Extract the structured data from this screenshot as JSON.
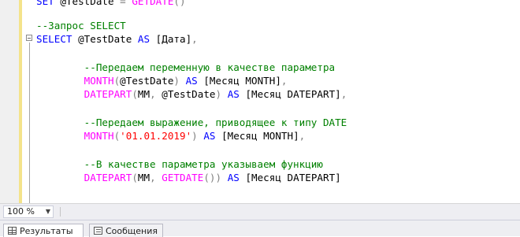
{
  "editor": {
    "lines": [
      {
        "top_clip": true,
        "segments": [
          {
            "c": "kw",
            "t": "SET "
          },
          {
            "c": "tx",
            "t": "@TestDate "
          },
          {
            "c": "op",
            "t": "= "
          },
          {
            "c": "fn",
            "t": "GETDATE"
          },
          {
            "c": "op",
            "t": "()"
          }
        ]
      },
      {
        "segments": [
          {
            "c": "cm",
            "t": "--Запрос SELECT"
          }
        ]
      },
      {
        "segments": [
          {
            "c": "kw",
            "t": "SELECT "
          },
          {
            "c": "tx",
            "t": "@TestDate "
          },
          {
            "c": "kw",
            "t": "AS "
          },
          {
            "c": "tx",
            "t": "[Дата]"
          },
          {
            "c": "op",
            "t": ","
          }
        ]
      },
      {
        "segments": [
          {
            "c": "cm",
            "t": "        --Передаем переменную в качестве параметра"
          }
        ]
      },
      {
        "segments": [
          {
            "c": "fn",
            "t": "        MONTH"
          },
          {
            "c": "op",
            "t": "("
          },
          {
            "c": "tx",
            "t": "@TestDate"
          },
          {
            "c": "op",
            "t": ") "
          },
          {
            "c": "kw",
            "t": "AS "
          },
          {
            "c": "tx",
            "t": "[Месяц MONTH]"
          },
          {
            "c": "op",
            "t": ","
          }
        ]
      },
      {
        "segments": [
          {
            "c": "fn",
            "t": "        DATEPART"
          },
          {
            "c": "op",
            "t": "("
          },
          {
            "c": "tx",
            "t": "MM"
          },
          {
            "c": "op",
            "t": ", "
          },
          {
            "c": "tx",
            "t": "@TestDate"
          },
          {
            "c": "op",
            "t": ") "
          },
          {
            "c": "kw",
            "t": "AS "
          },
          {
            "c": "tx",
            "t": "[Месяц DATEPART]"
          },
          {
            "c": "op",
            "t": ","
          }
        ]
      },
      {
        "segments": [
          {
            "c": "cm",
            "t": "        --Передаем выражение, приводящее к типу DATE"
          }
        ]
      },
      {
        "segments": [
          {
            "c": "fn",
            "t": "        MONTH"
          },
          {
            "c": "op",
            "t": "("
          },
          {
            "c": "str",
            "t": "'01.01.2019'"
          },
          {
            "c": "op",
            "t": ") "
          },
          {
            "c": "kw",
            "t": "AS "
          },
          {
            "c": "tx",
            "t": "[Месяц MONTH]"
          },
          {
            "c": "op",
            "t": ","
          }
        ]
      },
      {
        "segments": [
          {
            "c": "cm",
            "t": "        --В качестве параметра указываем функцию"
          }
        ]
      },
      {
        "segments": [
          {
            "c": "fn",
            "t": "        DATEPART"
          },
          {
            "c": "op",
            "t": "("
          },
          {
            "c": "tx",
            "t": "MM"
          },
          {
            "c": "op",
            "t": ", "
          },
          {
            "c": "fn",
            "t": "GETDATE"
          },
          {
            "c": "op",
            "t": "()) "
          },
          {
            "c": "kw",
            "t": "AS "
          },
          {
            "c": "tx",
            "t": "[Месяц DATEPART]"
          }
        ]
      }
    ]
  },
  "statusbar": {
    "zoom": "100 %"
  },
  "tabs": [
    {
      "label": "Результаты",
      "icon": "results-grid-icon",
      "active": true
    },
    {
      "label": "Сообщения",
      "icon": "messages-icon",
      "active": false
    }
  ],
  "colors": {
    "keyword": "#0000ff",
    "function": "#ff00ff",
    "comment": "#008000",
    "string": "#ff0000",
    "operator": "#808080",
    "text": "#000000"
  }
}
